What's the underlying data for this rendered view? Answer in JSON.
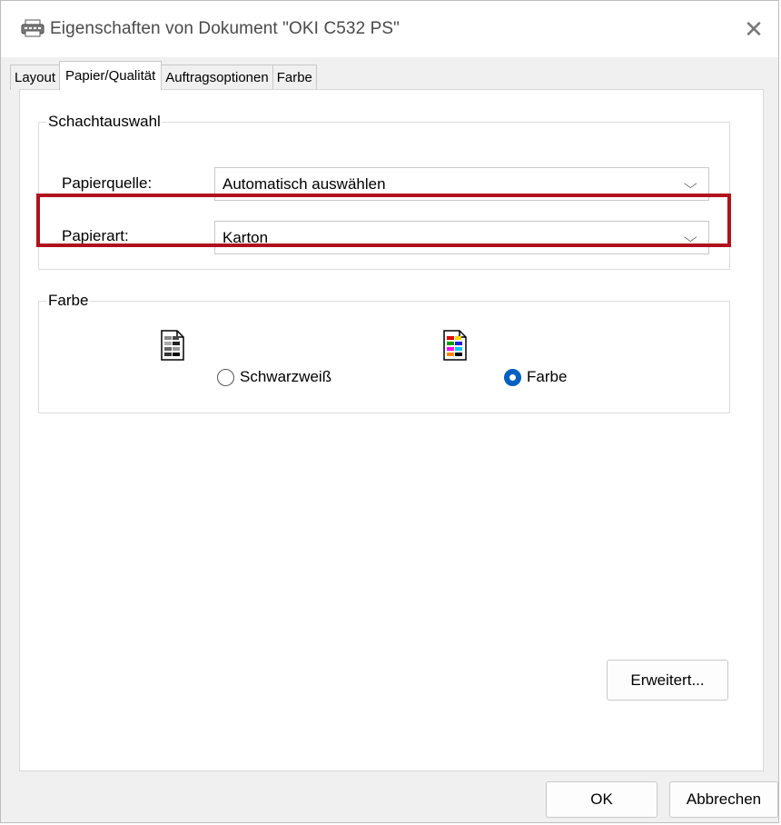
{
  "window": {
    "title": "Eigenschaften von Dokument \"OKI C532 PS\"",
    "close_glyph": "✕"
  },
  "tabs": [
    {
      "label": "Layout",
      "active": false
    },
    {
      "label": "Papier/Qualität",
      "active": true
    },
    {
      "label": "Auftragsoptionen",
      "active": false
    },
    {
      "label": "Farbe",
      "active": false
    }
  ],
  "tray_group": {
    "legend": "Schachtauswahl",
    "paper_source": {
      "label": "Papierquelle:",
      "value": "Automatisch auswählen"
    },
    "paper_type": {
      "label": "Papierart:",
      "value": "Karton"
    }
  },
  "color_group": {
    "legend": "Farbe",
    "options": [
      {
        "label": "Schwarzweiß",
        "selected": false,
        "icon": "bw-document-icon"
      },
      {
        "label": "Farbe",
        "selected": true,
        "icon": "color-document-icon"
      }
    ]
  },
  "buttons": {
    "advanced": "Erweitert...",
    "ok": "OK",
    "cancel": "Abbrechen"
  },
  "colors": {
    "highlight": "#b0121d",
    "radio_selected": "#0060c0"
  }
}
